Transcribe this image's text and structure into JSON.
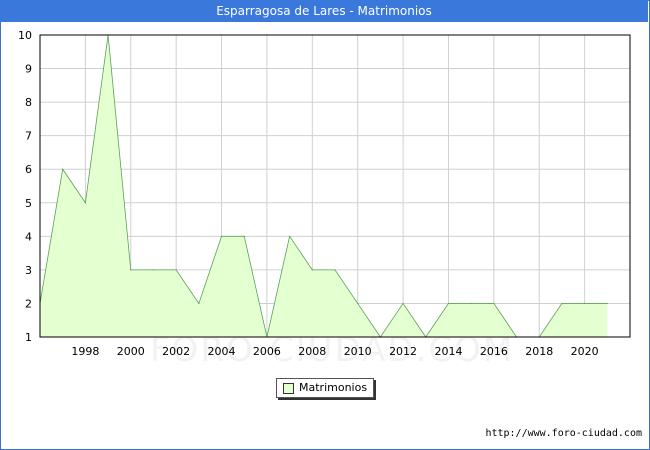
{
  "title": "Esparragosa de Lares - Matrimonios",
  "source": "http://www.foro-ciudad.com",
  "watermark": "FORO-CIUDAD.COM",
  "colors": {
    "fill": "#e4ffd0",
    "line": "#5aa05a",
    "grid": "#d0d0d0",
    "title_bg": "#3a78dc"
  },
  "chart_data": {
    "type": "area",
    "title": "Esparragosa de Lares - Matrimonios",
    "xlabel": "",
    "ylabel": "",
    "x": [
      1996,
      1997,
      1998,
      1999,
      2000,
      2001,
      2002,
      2003,
      2004,
      2005,
      2006,
      2007,
      2008,
      2009,
      2010,
      2011,
      2012,
      2013,
      2014,
      2015,
      2016,
      2017,
      2018,
      2019,
      2020,
      2021
    ],
    "series": [
      {
        "name": "Matrimonios",
        "values": [
          2,
          6,
          5,
          10,
          3,
          3,
          3,
          2,
          4,
          4,
          1,
          4,
          3,
          3,
          2,
          1,
          2,
          1,
          2,
          2,
          2,
          1,
          1,
          2,
          2,
          2
        ]
      }
    ],
    "xlim": [
      1996,
      2022.0
    ],
    "ylim": [
      1,
      10
    ],
    "xticks": [
      1998,
      2000,
      2002,
      2004,
      2006,
      2008,
      2010,
      2012,
      2014,
      2016,
      2018,
      2020
    ],
    "yticks": [
      1,
      2,
      3,
      4,
      5,
      6,
      7,
      8,
      9,
      10
    ],
    "grid": true,
    "legend": "bottom-center"
  }
}
